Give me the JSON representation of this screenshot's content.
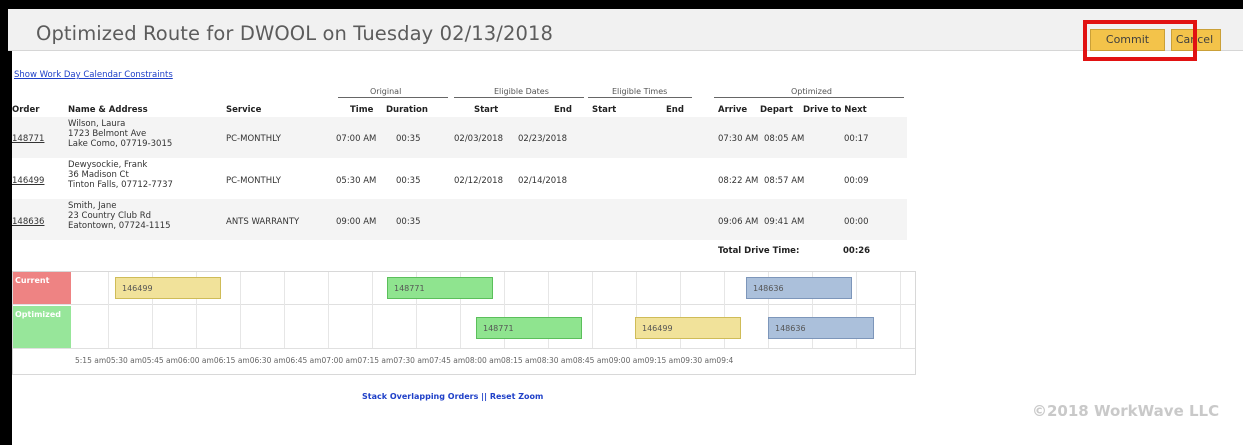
{
  "title": "Optimized Route for DWOOL on Tuesday 02/13/2018",
  "buttons": {
    "commit": "Commit",
    "cancel": "Cancel"
  },
  "constraints_link": "Show Work Day Calendar Constraints",
  "groups": {
    "original": "Original",
    "eligible_dates": "Eligible Dates",
    "eligible_times": "Eligible Times",
    "optimized": "Optimized"
  },
  "columns": {
    "order": "Order",
    "name_address": "Name & Address",
    "service": "Service",
    "time": "Time",
    "duration": "Duration",
    "start_date": "Start",
    "end_date": "End",
    "start_time": "Start",
    "end_time": "End",
    "arrive": "Arrive",
    "depart": "Depart",
    "drive": "Drive to Next"
  },
  "rows": [
    {
      "order": "148771",
      "name": "Wilson, Laura",
      "address": "1723 Belmont Ave",
      "city": "Lake Como, 07719-3015",
      "service": "PC-MONTHLY",
      "time": "07:00 AM",
      "duration": "00:35",
      "start_date": "02/03/2018",
      "end_date": "02/23/2018",
      "start_time": "",
      "end_time": "",
      "arrive": "07:30 AM",
      "depart": "08:05 AM",
      "drive": "00:17"
    },
    {
      "order": "146499",
      "name": "Dewysockie, Frank",
      "address": "36 Madison Ct",
      "city": "Tinton Falls, 07712-7737",
      "service": "PC-MONTHLY",
      "time": "05:30 AM",
      "duration": "00:35",
      "start_date": "02/12/2018",
      "end_date": "02/14/2018",
      "start_time": "",
      "end_time": "",
      "arrive": "08:22 AM",
      "depart": "08:57 AM",
      "drive": "00:09"
    },
    {
      "order": "148636",
      "name": "Smith, Jane",
      "address": "23 Country Club Rd",
      "city": "Eatontown, 07724-1115",
      "service": "ANTS WARRANTY",
      "time": "09:00 AM",
      "duration": "00:35",
      "start_date": "",
      "end_date": "",
      "start_time": "",
      "end_time": "",
      "arrive": "09:06 AM",
      "depart": "09:41 AM",
      "drive": "00:00"
    }
  ],
  "total": {
    "label": "Total Drive Time:",
    "value": "00:26"
  },
  "timeline": {
    "current_label": "Current",
    "optimized_label": "Optimized",
    "current_blocks": [
      "146499",
      "148771",
      "148636"
    ],
    "optimized_blocks": [
      "148771",
      "146499",
      "148636"
    ],
    "axis_text": "5:15 am05:30 am05:45 am06:00 am06:15 am06:30 am06:45 am07:00 am07:15 am07:30 am07:45 am08:00 am08:15 am08:30 am08:45 am09:00 am09:15 am09:30 am09:4"
  },
  "stack_link": "Stack Overlapping Orders",
  "link_separator": "||",
  "reset_link": "Reset Zoom",
  "copyright": "©2018 WorkWave LLC",
  "colors": {
    "accent_button": "#f3c34a",
    "highlight": "#e11212",
    "current": "#ee8383",
    "optimized": "#97e69a"
  }
}
